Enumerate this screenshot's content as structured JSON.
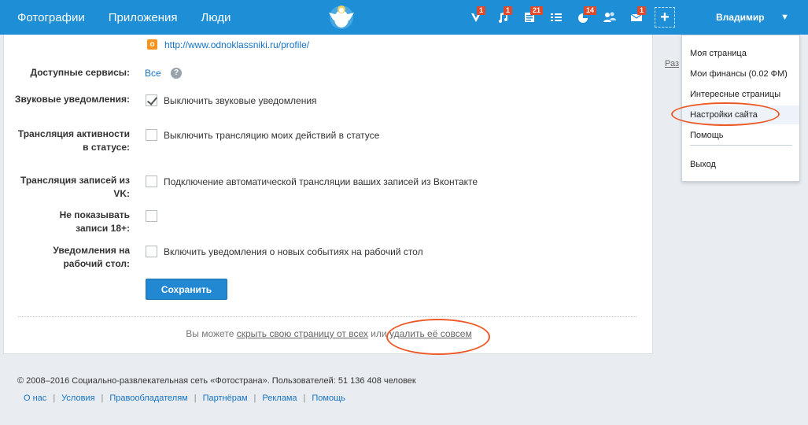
{
  "nav": {
    "items": [
      "Фотографии",
      "Приложения",
      "Люди"
    ]
  },
  "top_icons": [
    {
      "icon": "v-icon",
      "badge": "1"
    },
    {
      "icon": "music-icon",
      "badge": "1"
    },
    {
      "icon": "news-icon",
      "badge": "21"
    },
    {
      "icon": "list-icon",
      "badge": ""
    },
    {
      "icon": "pie-icon",
      "badge": "14"
    },
    {
      "icon": "friends-icon",
      "badge": ""
    },
    {
      "icon": "mail-icon",
      "badge": "1"
    }
  ],
  "user": {
    "name": "Владимир"
  },
  "dropdown": {
    "items": [
      "Моя страница",
      "Мои финансы (0.02 ФМ)",
      "Интересные страницы",
      "Настройки сайта",
      "Помощь",
      "Выход"
    ]
  },
  "side": {
    "link": "Раз"
  },
  "settings": {
    "profile_link": "http://www.odnoklassniki.ru/profile/",
    "services_label": "Доступные сервисы:",
    "services_value": "Все",
    "rows": [
      {
        "label": "Звуковые уведомления:",
        "text": "Выключить звуковые уведомления",
        "checked": true
      },
      {
        "label": "Трансляция активности в статусе:",
        "text": "Выключить трансляцию моих действий в статусе",
        "checked": false
      },
      {
        "label": "Трансляция записей из VK:",
        "text": "Подключение автоматической трансляции ваших записей из Вконтакте",
        "checked": false
      },
      {
        "label": "Не показывать записи 18+:",
        "text": "",
        "checked": false
      },
      {
        "label": "Уведомления на рабочий стол:",
        "text": "Включить уведомления о новых событиях на рабочий стол",
        "checked": false
      }
    ],
    "save_label": "Сохранить",
    "bottom_prefix": "Вы можете",
    "hide_link": "скрыть свою страницу от всех",
    "or_text": "или",
    "delete_link": "удалить её совсем"
  },
  "footer": {
    "copyright": "© 2008–2016 Социально-развлекательная сеть «Фотострана». Пользователей: 51 136 408 человек",
    "links": [
      "О нас",
      "Условия",
      "Правообладателям",
      "Партнёрам",
      "Реклама",
      "Помощь"
    ]
  },
  "colors": {
    "topbar": "#1e8fd6",
    "accent": "#2288d2",
    "annotation": "#ec5a28"
  }
}
